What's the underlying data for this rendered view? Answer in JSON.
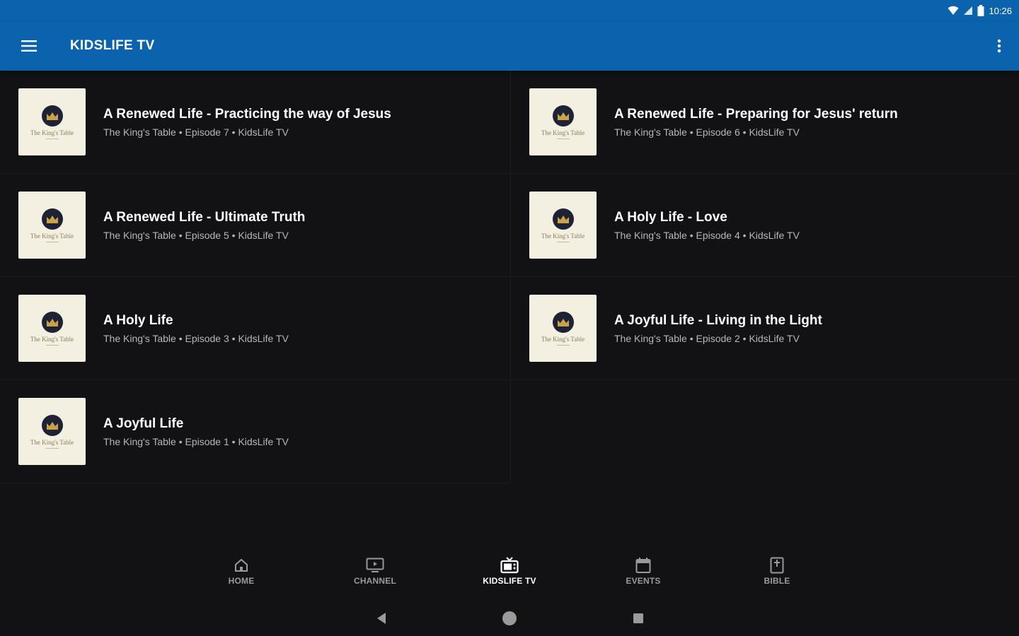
{
  "status_bar": {
    "time": "10:26",
    "icons": [
      "wifi-icon",
      "signal-icon",
      "battery-icon"
    ]
  },
  "app_bar": {
    "title": "KIDSLIFE TV",
    "menu_icon": "hamburger-menu-icon",
    "overflow_icon": "more-vert-icon"
  },
  "thumbnail": {
    "brand": "The King's Table"
  },
  "episodes": [
    {
      "title": "A Renewed Life - Practicing the way of Jesus",
      "subtitle": "The King's Table • Episode 7 • KidsLife TV"
    },
    {
      "title": "A Renewed Life - Preparing for Jesus' return",
      "subtitle": "The King's Table • Episode 6 • KidsLife TV"
    },
    {
      "title": "A Renewed Life - Ultimate Truth",
      "subtitle": "The King's Table • Episode 5 • KidsLife TV"
    },
    {
      "title": "A Holy Life - Love",
      "subtitle": "The King's Table • Episode 4 • KidsLife TV"
    },
    {
      "title": "A Holy Life",
      "subtitle": "The King's Table • Episode 3 • KidsLife TV"
    },
    {
      "title": "A Joyful Life - Living in the Light",
      "subtitle": "The King's Table • Episode 2 • KidsLife TV"
    },
    {
      "title": "A Joyful Life",
      "subtitle": "The King's Table • Episode 1 • KidsLife TV"
    }
  ],
  "bottom_nav": [
    {
      "label": "HOME",
      "icon": "home-icon",
      "active": false
    },
    {
      "label": "CHANNEL",
      "icon": "channel-icon",
      "active": false
    },
    {
      "label": "KIDSLIFE TV",
      "icon": "tv-icon",
      "active": true
    },
    {
      "label": "EVENTS",
      "icon": "calendar-icon",
      "active": false
    },
    {
      "label": "BIBLE",
      "icon": "bible-icon",
      "active": false
    }
  ],
  "system_nav": {
    "back": "back-icon",
    "home": "home-circle-icon",
    "recents": "recents-icon"
  },
  "colors": {
    "app_bar": "#0b63ae",
    "background": "#121215",
    "thumbnail_bg": "#f3efe1",
    "badge": "#1d2235",
    "gold": "#c9a24a"
  }
}
